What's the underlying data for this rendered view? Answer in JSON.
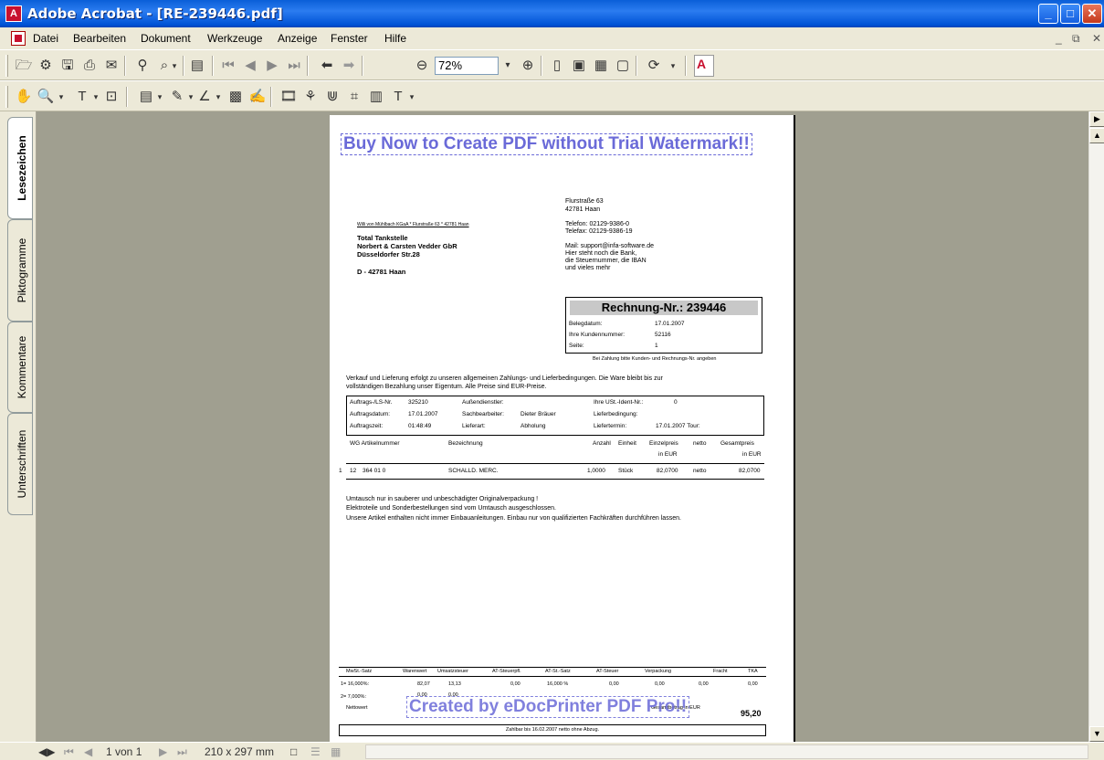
{
  "window": {
    "title": "Adobe Acrobat - [RE-239446.pdf]"
  },
  "menu": [
    "Datei",
    "Bearbeiten",
    "Dokument",
    "Werkzeuge",
    "Anzeige",
    "Fenster",
    "Hilfe"
  ],
  "toolbar": {
    "zoom_value": "72%"
  },
  "sidetabs": [
    "Lesezeichen",
    "Piktogramme",
    "Kommentare",
    "Unterschriften"
  ],
  "status": {
    "page_display": "1 von 1",
    "page_size": "210 x 297 mm"
  },
  "document": {
    "watermark_top": "Buy Now to Create PDF without Trial Watermark!!",
    "watermark_bottom": "Created by eDocPrinter PDF Pro!!",
    "sender_line": "Willi von Mühlbach KGaA * Flurstraße 63 * 42781 Haan",
    "company_address": [
      "Flurstraße 63",
      "42781 Haan"
    ],
    "company_phone": [
      "Telefon: 02129-9386-0",
      "Telefax: 02129-9386-19"
    ],
    "company_note": [
      "Mail: support@infa-software.de",
      "Hier steht noch die Bank,",
      "die Steuernummer, die IBAN",
      "und vieles mehr"
    ],
    "recipient": [
      "Total Tankstelle",
      "Norbert & Carsten Vedder GbR",
      "Düsseldorfer Str.28"
    ],
    "recipient_city": "D - 42781  Haan",
    "invoice": {
      "title": "Rechnung-Nr.: 239446",
      "rows": [
        {
          "label": "Belegdatum:",
          "value": "17.01.2007"
        },
        {
          "label": "Ihre Kundennummer:",
          "value": "52116"
        },
        {
          "label": "Seite:",
          "value": "1"
        }
      ],
      "note": "Bei Zahlung bitte Kunden- und Rechnungs-Nr. angeben"
    },
    "terms": [
      "Verkauf und Lieferung erfolgt zu unseren allgemeinen Zahlungs- und Lieferbedingungen. Die Ware bleibt bis zur",
      "vollständigen Bezahlung unser Eigentum. Alle Preise sind EUR-Preise."
    ],
    "order": {
      "r1": [
        "Auftrags-/LS-Nr.",
        "325210",
        "Außendienstler:",
        "",
        "Ihre USt.-Ident-Nr.:",
        "0"
      ],
      "r2": [
        "Auftragsdatum:",
        "17.01.2007",
        "Sachbearbeiter:",
        "Dieter Bräuer",
        "Lieferbedingung:",
        ""
      ],
      "r3": [
        "Auftragszeit:",
        "01:48:49",
        "Lieferart:",
        "Abholung",
        "Liefertermin:",
        "17.01.2007 Tour:"
      ]
    },
    "items_header": {
      "wg_art": "WG Artikelnummer",
      "desc": "Bezeichnung",
      "qty": "Anzahl",
      "unit": "Einheit",
      "price": "Einzelpreis",
      "price_cur": "in EUR",
      "netto": "netto",
      "total": "Gesamtpreis",
      "total_cur": "in EUR"
    },
    "item": {
      "pos": "1",
      "wg": "12",
      "art": "364 01 0",
      "desc": "SCHALLD. MERC.",
      "qty": "1,0000",
      "unit": "Stück",
      "price": "82,0700",
      "netto": "netto",
      "total": "82,0700"
    },
    "remarks": [
      "Umtausch nur in sauberer und unbeschädigter Originalverpackung !",
      "Elektroteile und Sonderbestellungen sind vom Umtausch ausgeschlossen.",
      "Unsere Artikel enthalten nicht immer Einbauanleitungen. Einbau nur von qualifizierten Fachkräften durchführen lassen."
    ],
    "footer": {
      "header": [
        "MwSt.-Satz",
        "Warenwert",
        "Umsatzsteuer",
        "AT-Steuerpfl.",
        "AT-St.-Satz",
        "AT-Steuer",
        "Verpackung",
        "Fracht",
        "TKA"
      ],
      "row1": [
        "1= 16,000%:",
        "82,07",
        "13,13",
        "0,00",
        "16,000 %",
        "0,00",
        "0,00",
        "0,00",
        "0,00"
      ],
      "row2": [
        "2=  7,000%:",
        "0,00",
        "0,00"
      ],
      "netto_label": "Nettowert",
      "gross_label": "Gesamtbetrag in EUR",
      "total": "95,20",
      "payment": "Zahlbar bis 16.02.2007 netto ohne Abzug."
    }
  }
}
